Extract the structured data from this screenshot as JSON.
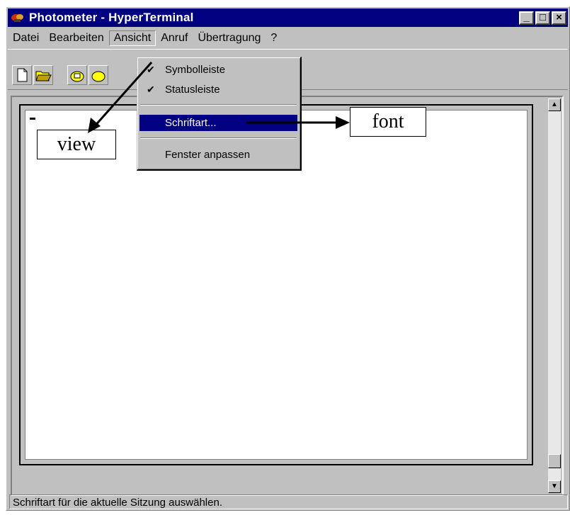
{
  "window": {
    "title": "Photometer - HyperTerminal",
    "buttons": [
      "_",
      "□",
      "×"
    ]
  },
  "menubar": {
    "items": [
      "Datei",
      "Bearbeiten",
      "Ansicht",
      "Anruf",
      "Übertragung",
      "?"
    ]
  },
  "view_menu": {
    "items": [
      {
        "label": "Symbolleiste",
        "checked": true
      },
      {
        "label": "Statusleiste",
        "checked": true
      },
      {
        "label": "Schriftart...",
        "selected": true
      },
      {
        "label": "Fenster anpassen"
      }
    ],
    "check_glyph": "✔"
  },
  "statusbar": {
    "text": "Schriftart für die aktuelle Sitzung auswählen."
  },
  "annotations": {
    "view": "view",
    "font": "font"
  },
  "colors": {
    "titlebar": "#000080",
    "selection": "#000080",
    "face": "#c0c0c0"
  }
}
